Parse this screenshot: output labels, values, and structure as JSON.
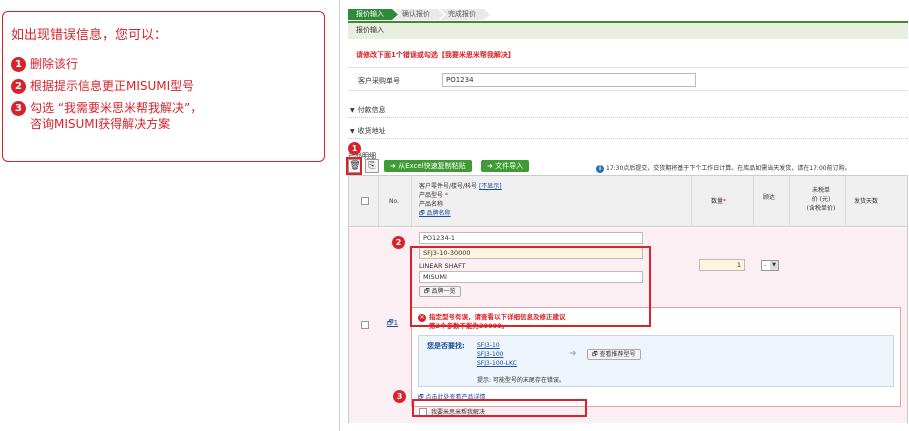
{
  "callout": {
    "title": "如出现错误信息，您可以：",
    "steps": [
      {
        "num": "1",
        "text": "删除该行"
      },
      {
        "num": "2",
        "text": "根据提示信息更正MISUMI型号"
      },
      {
        "num": "3",
        "line1": "勾选 “我需要米思米帮我解决”，",
        "line2": "咨询MISUMI获得解决方案"
      }
    ]
  },
  "steps_nav": [
    "报价输入",
    "确认报价",
    "完成报价"
  ],
  "panel_title": "报价输入",
  "error_title": "请修改下面1个错误或勾选【我要米思米帮我解决】",
  "order_no": {
    "label": "客户采购单号",
    "value": "PO1234"
  },
  "sections": {
    "payment": "付款信息",
    "shipping": "收货地址"
  },
  "toolbar": {
    "label": "产品明细",
    "excel_btn": "从Excel快速复制粘贴",
    "import_btn": "文件导入",
    "info": "17:30点后提交，交货期将基于下个工作日计算。在库品如需当天发货，请在17:00前订购。"
  },
  "table": {
    "headers": {
      "no": "No.",
      "part_line1": "客户零件号/楼号/科号",
      "part_hide": "[不显示]",
      "part_line2": "产品型号",
      "part_line3": "产品名称",
      "brand": "品牌名称",
      "qty": "数量",
      "urgent": "顾达",
      "price_l1": "未税单",
      "price_l2": "价 (元)",
      "price_l3": "(含税单价)",
      "ship": "发货天数"
    },
    "row": {
      "no": "1",
      "customer_part": "PO1234-1",
      "model": "SFJ3-10-30000",
      "product_name": "LINEAR SHAFT",
      "brand": "MISUMI",
      "brand_list_btn": "品牌一览",
      "qty": "1",
      "urgent": "-",
      "error_line1": "指定型号有误，请查看以下详细信息及修正建议",
      "error_line2": "第3个参数不能为30000。",
      "suggest_label": "您是否要找:",
      "suggestions": [
        "SFJ3-10",
        "SFJ3-100",
        "SFJ3-100-LKC"
      ],
      "recommend_btn": "查看推荐型号",
      "hint": "提示: 可能型号的末尾存在错误。",
      "detail_link": "点击此处查看产品详情",
      "help_checkbox": "我要米思米帮我解决"
    }
  },
  "badges": [
    "1",
    "2",
    "3"
  ],
  "colors": {
    "accent_red": "#d9232a",
    "green": "#3f9b35"
  }
}
